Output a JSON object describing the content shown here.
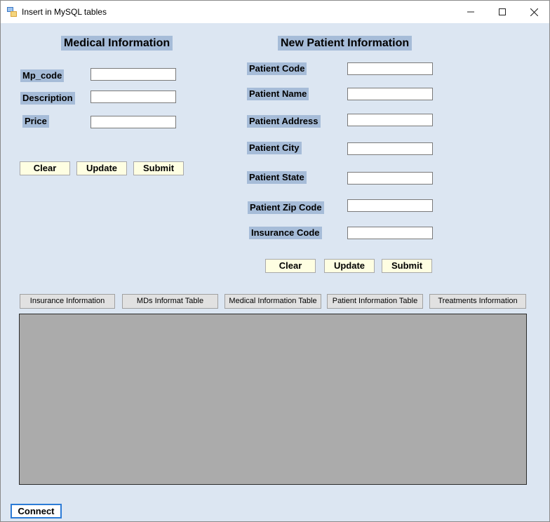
{
  "window": {
    "title": "Insert in MySQL tables"
  },
  "medical": {
    "header": "Medical Information",
    "fields": [
      {
        "label": "Mp_code",
        "value": ""
      },
      {
        "label": "Description",
        "value": ""
      },
      {
        "label": "Price",
        "value": ""
      }
    ],
    "buttons": {
      "clear": "Clear",
      "update": "Update",
      "submit": "Submit"
    }
  },
  "patient": {
    "header": "New Patient Information",
    "fields": [
      {
        "label": "Patient Code",
        "value": ""
      },
      {
        "label": "Patient Name",
        "value": ""
      },
      {
        "label": "Patient Address",
        "value": ""
      },
      {
        "label": "Patient City",
        "value": ""
      },
      {
        "label": "Patient State",
        "value": ""
      },
      {
        "label": "Patient Zip Code",
        "value": ""
      },
      {
        "label": "Insurance Code",
        "value": ""
      }
    ],
    "buttons": {
      "clear": "Clear",
      "update": "Update",
      "submit": "Submit"
    }
  },
  "tables": [
    "Insurance Information",
    "MDs Informat Table",
    "Medical Information Table",
    "Patient Information Table",
    "Treatments Information"
  ],
  "connect_label": "Connect"
}
